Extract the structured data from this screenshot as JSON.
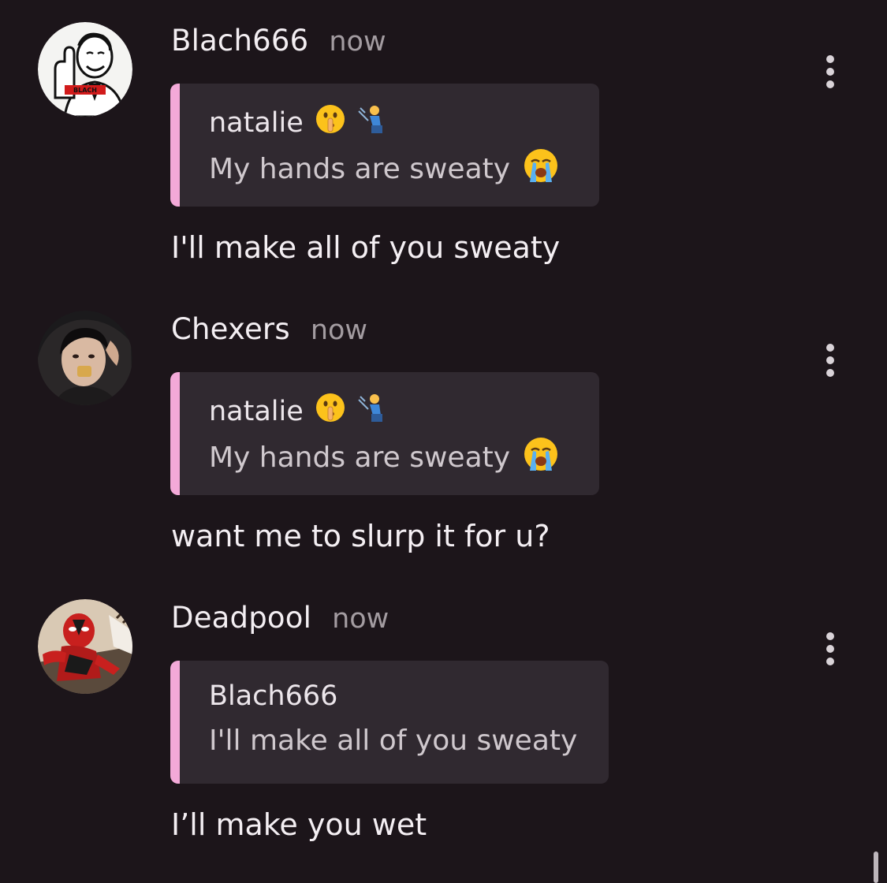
{
  "messages": [
    {
      "username": "Blach666",
      "timestamp": "now",
      "avatar_icon": "meme-man-avatar",
      "quote": {
        "author": "natalie",
        "author_emojis": [
          "shushing-face-icon",
          "person-kneeling-icon"
        ],
        "text": "My hands are sweaty",
        "text_emoji": "loudly-crying-face-icon"
      },
      "body": "I'll make all of you sweaty"
    },
    {
      "username": "Chexers",
      "timestamp": "now",
      "avatar_icon": "photo-avatar",
      "quote": {
        "author": "natalie",
        "author_emojis": [
          "shushing-face-icon",
          "person-kneeling-icon"
        ],
        "text": "My hands are sweaty",
        "text_emoji": "loudly-crying-face-icon"
      },
      "body": "want me to slurp it for u?"
    },
    {
      "username": "Deadpool",
      "timestamp": "now",
      "avatar_icon": "deadpool-avatar",
      "quote": {
        "author": "Blach666",
        "text": "I'll make all of you sweaty"
      },
      "body": "I’ll make you wet"
    }
  ],
  "colors": {
    "background": "#1c151a",
    "quote_background": "#302930",
    "quote_accent": "#f3a9d8",
    "timestamp": "#a39ca1"
  },
  "icons": {
    "more_options": "vertical-ellipsis-icon"
  }
}
